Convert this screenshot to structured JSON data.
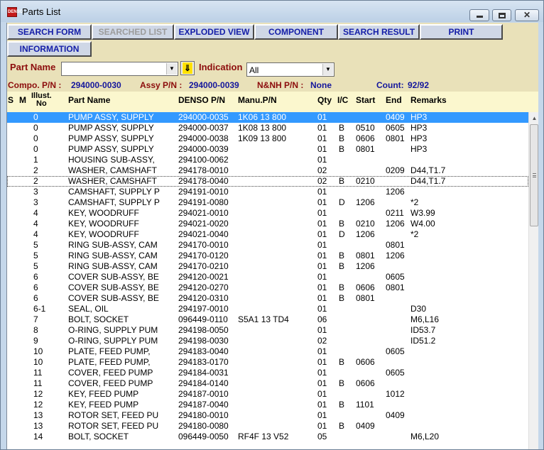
{
  "window": {
    "title": "Parts List",
    "icon_label": "DENSO"
  },
  "toolbar": {
    "search_form": "SEARCH FORM",
    "searched_list": "SEARCHED LIST",
    "exploded_view": "EXPLODED VIEW",
    "component": "COMPONENT",
    "search_result": "SEARCH RESULT",
    "print": "PRINT",
    "information": "INFORMATION"
  },
  "filters": {
    "part_name_label": "Part Name",
    "part_name_value": "",
    "indication_label": "Indication",
    "indication_value": "All"
  },
  "info": {
    "compo_label": "Compo. P/N :",
    "compo_value": "294000-0030",
    "assy_label": "Assy P/N :",
    "assy_value": "294000-0039",
    "nnh_label": "N&NH P/N :",
    "nnh_value": "None",
    "count_label": "Count:",
    "count_value": "92/92"
  },
  "columns": {
    "s": "S",
    "m": "M",
    "illust_1": "Illust.",
    "illust_2": "No",
    "part_name": "Part Name",
    "denso_pn": "DENSO P/N",
    "manu_pn": "Manu.P/N",
    "qty": "Qty",
    "ic": "I/C",
    "start": "Start",
    "end": "End",
    "remarks": "Remarks"
  },
  "rows": [
    {
      "illust": "0",
      "name": "PUMP ASSY, SUPPLY",
      "pn": "294000-0035",
      "manu": "1K06 13 800",
      "qty": "01",
      "ic": "",
      "start": "",
      "end": "0409",
      "remarks": "HP3"
    },
    {
      "illust": "0",
      "name": "PUMP ASSY, SUPPLY",
      "pn": "294000-0037",
      "manu": "1K08 13 800",
      "qty": "01",
      "ic": "B",
      "start": "0510",
      "end": "0605",
      "remarks": "HP3"
    },
    {
      "illust": "0",
      "name": "PUMP ASSY, SUPPLY",
      "pn": "294000-0038",
      "manu": "1K09 13 800",
      "qty": "01",
      "ic": "B",
      "start": "0606",
      "end": "0801",
      "remarks": "HP3"
    },
    {
      "illust": "0",
      "name": "PUMP ASSY, SUPPLY",
      "pn": "294000-0039",
      "manu": "",
      "qty": "01",
      "ic": "B",
      "start": "0801",
      "end": "",
      "remarks": "HP3"
    },
    {
      "illust": "1",
      "name": "HOUSING SUB-ASSY,",
      "pn": "294100-0062",
      "manu": "",
      "qty": "01",
      "ic": "",
      "start": "",
      "end": "",
      "remarks": ""
    },
    {
      "illust": "2",
      "name": "WASHER, CAMSHAFT",
      "pn": "294178-0010",
      "manu": "",
      "qty": "02",
      "ic": "",
      "start": "",
      "end": "0209",
      "remarks": "D44,T1.7"
    },
    {
      "illust": "2",
      "name": "WASHER, CAMSHAFT",
      "pn": "294178-0040",
      "manu": "",
      "qty": "02",
      "ic": "B",
      "start": "0210",
      "end": "",
      "remarks": "D44,T1.7"
    },
    {
      "illust": "3",
      "name": "CAMSHAFT, SUPPLY P",
      "pn": "294191-0010",
      "manu": "",
      "qty": "01",
      "ic": "",
      "start": "",
      "end": "1206",
      "remarks": ""
    },
    {
      "illust": "3",
      "name": "CAMSHAFT, SUPPLY P",
      "pn": "294191-0080",
      "manu": "",
      "qty": "01",
      "ic": "D",
      "start": "1206",
      "end": "",
      "remarks": "*2"
    },
    {
      "illust": "4",
      "name": "KEY, WOODRUFF",
      "pn": "294021-0010",
      "manu": "",
      "qty": "01",
      "ic": "",
      "start": "",
      "end": "0211",
      "remarks": "W3.99"
    },
    {
      "illust": "4",
      "name": "KEY, WOODRUFF",
      "pn": "294021-0020",
      "manu": "",
      "qty": "01",
      "ic": "B",
      "start": "0210",
      "end": "1206",
      "remarks": "W4.00"
    },
    {
      "illust": "4",
      "name": "KEY, WOODRUFF",
      "pn": "294021-0040",
      "manu": "",
      "qty": "01",
      "ic": "D",
      "start": "1206",
      "end": "",
      "remarks": "*2"
    },
    {
      "illust": "5",
      "name": "RING SUB-ASSY, CAM",
      "pn": "294170-0010",
      "manu": "",
      "qty": "01",
      "ic": "",
      "start": "",
      "end": "0801",
      "remarks": ""
    },
    {
      "illust": "5",
      "name": "RING SUB-ASSY, CAM",
      "pn": "294170-0120",
      "manu": "",
      "qty": "01",
      "ic": "B",
      "start": "0801",
      "end": "1206",
      "remarks": ""
    },
    {
      "illust": "5",
      "name": "RING SUB-ASSY, CAM",
      "pn": "294170-0210",
      "manu": "",
      "qty": "01",
      "ic": "B",
      "start": "1206",
      "end": "",
      "remarks": ""
    },
    {
      "illust": "6",
      "name": "COVER SUB-ASSY, BE",
      "pn": "294120-0021",
      "manu": "",
      "qty": "01",
      "ic": "",
      "start": "",
      "end": "0605",
      "remarks": ""
    },
    {
      "illust": "6",
      "name": "COVER SUB-ASSY, BE",
      "pn": "294120-0270",
      "manu": "",
      "qty": "01",
      "ic": "B",
      "start": "0606",
      "end": "0801",
      "remarks": ""
    },
    {
      "illust": "6",
      "name": "COVER SUB-ASSY, BE",
      "pn": "294120-0310",
      "manu": "",
      "qty": "01",
      "ic": "B",
      "start": "0801",
      "end": "",
      "remarks": ""
    },
    {
      "illust": "6-1",
      "name": "SEAL, OIL",
      "pn": "294197-0010",
      "manu": "",
      "qty": "01",
      "ic": "",
      "start": "",
      "end": "",
      "remarks": "D30"
    },
    {
      "illust": "7",
      "name": "BOLT, SOCKET",
      "pn": "096449-0110",
      "manu": "S5A1 13 TD4",
      "qty": "06",
      "ic": "",
      "start": "",
      "end": "",
      "remarks": "M6,L16"
    },
    {
      "illust": "8",
      "name": "O-RING, SUPPLY PUM",
      "pn": "294198-0050",
      "manu": "",
      "qty": "01",
      "ic": "",
      "start": "",
      "end": "",
      "remarks": "ID53.7"
    },
    {
      "illust": "9",
      "name": "O-RING, SUPPLY PUM",
      "pn": "294198-0030",
      "manu": "",
      "qty": "02",
      "ic": "",
      "start": "",
      "end": "",
      "remarks": "ID51.2"
    },
    {
      "illust": "10",
      "name": "PLATE, FEED PUMP,",
      "pn": "294183-0040",
      "manu": "",
      "qty": "01",
      "ic": "",
      "start": "",
      "end": "0605",
      "remarks": ""
    },
    {
      "illust": "10",
      "name": "PLATE, FEED PUMP,",
      "pn": "294183-0170",
      "manu": "",
      "qty": "01",
      "ic": "B",
      "start": "0606",
      "end": "",
      "remarks": ""
    },
    {
      "illust": "11",
      "name": "COVER, FEED PUMP",
      "pn": "294184-0031",
      "manu": "",
      "qty": "01",
      "ic": "",
      "start": "",
      "end": "0605",
      "remarks": ""
    },
    {
      "illust": "11",
      "name": "COVER, FEED PUMP",
      "pn": "294184-0140",
      "manu": "",
      "qty": "01",
      "ic": "B",
      "start": "0606",
      "end": "",
      "remarks": ""
    },
    {
      "illust": "12",
      "name": "KEY, FEED PUMP",
      "pn": "294187-0010",
      "manu": "",
      "qty": "01",
      "ic": "",
      "start": "",
      "end": "1012",
      "remarks": ""
    },
    {
      "illust": "12",
      "name": "KEY, FEED PUMP",
      "pn": "294187-0040",
      "manu": "",
      "qty": "01",
      "ic": "B",
      "start": "1101",
      "end": "",
      "remarks": ""
    },
    {
      "illust": "13",
      "name": "ROTOR SET, FEED PU",
      "pn": "294180-0010",
      "manu": "",
      "qty": "01",
      "ic": "",
      "start": "",
      "end": "0409",
      "remarks": ""
    },
    {
      "illust": "13",
      "name": "ROTOR SET, FEED PU",
      "pn": "294180-0080",
      "manu": "",
      "qty": "01",
      "ic": "B",
      "start": "0409",
      "end": "",
      "remarks": ""
    },
    {
      "illust": "14",
      "name": "BOLT, SOCKET",
      "pn": "096449-0050",
      "manu": "RF4F 13 V52",
      "qty": "05",
      "ic": "",
      "start": "",
      "end": "",
      "remarks": "M6,L20"
    }
  ],
  "selected_row": 0,
  "focused_row": 6,
  "colors": {
    "selection": "#3399ff",
    "button_text": "#141ea8",
    "label_red": "#8c0c0c",
    "info_blue": "#14169c",
    "panel": "#e9e1b9",
    "header_strip": "#fbf7ce"
  },
  "scrollbar": {
    "position": 0.0,
    "visible_fraction": 0.33
  }
}
